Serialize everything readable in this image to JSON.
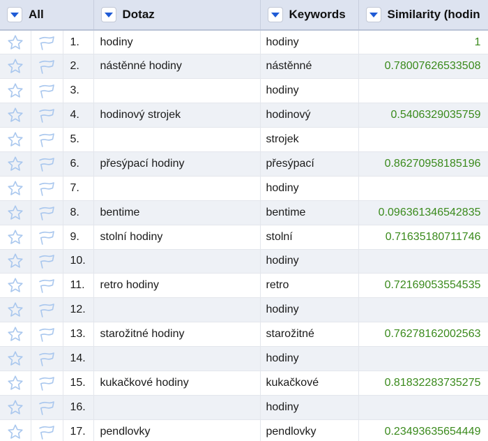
{
  "header": {
    "all_label": "All",
    "dotaz_label": "Dotaz",
    "keywords_label": "Keywords",
    "similarity_label": "Similarity (hodin"
  },
  "icons": {
    "dropdown": "triangle-down-icon",
    "star": "star-icon",
    "flag": "flag-icon"
  },
  "colors": {
    "header_bg": "#dde3f0",
    "dropdown_triangle": "#1f5bd6",
    "icon_outline": "#a9c7ee",
    "similarity_text": "#3a8a1c",
    "row_alt": "#eef1f6"
  },
  "rows": [
    {
      "num": "1.",
      "dotaz": "hodiny",
      "keyword": "hodiny",
      "similarity": "1"
    },
    {
      "num": "2.",
      "dotaz": "nástěnné hodiny",
      "keyword": "nástěnné",
      "similarity": "0.78007626533508"
    },
    {
      "num": "3.",
      "dotaz": "",
      "keyword": "hodiny",
      "similarity": ""
    },
    {
      "num": "4.",
      "dotaz": "hodinový strojek",
      "keyword": "hodinový",
      "similarity": "0.5406329035759"
    },
    {
      "num": "5.",
      "dotaz": "",
      "keyword": "strojek",
      "similarity": ""
    },
    {
      "num": "6.",
      "dotaz": "přesýpací hodiny",
      "keyword": "přesýpací",
      "similarity": "0.86270958185196"
    },
    {
      "num": "7.",
      "dotaz": "",
      "keyword": "hodiny",
      "similarity": ""
    },
    {
      "num": "8.",
      "dotaz": "bentime",
      "keyword": "bentime",
      "similarity": "0.096361346542835"
    },
    {
      "num": "9.",
      "dotaz": "stolní hodiny",
      "keyword": "stolní",
      "similarity": "0.71635180711746"
    },
    {
      "num": "10.",
      "dotaz": "",
      "keyword": "hodiny",
      "similarity": ""
    },
    {
      "num": "11.",
      "dotaz": "retro hodiny",
      "keyword": "retro",
      "similarity": "0.72169053554535"
    },
    {
      "num": "12.",
      "dotaz": "",
      "keyword": "hodiny",
      "similarity": ""
    },
    {
      "num": "13.",
      "dotaz": "starožitné hodiny",
      "keyword": "starožitné",
      "similarity": "0.76278162002563"
    },
    {
      "num": "14.",
      "dotaz": "",
      "keyword": "hodiny",
      "similarity": ""
    },
    {
      "num": "15.",
      "dotaz": "kukačkové hodiny",
      "keyword": "kukačkové",
      "similarity": "0.81832283735275"
    },
    {
      "num": "16.",
      "dotaz": "",
      "keyword": "hodiny",
      "similarity": ""
    },
    {
      "num": "17.",
      "dotaz": "pendlovky",
      "keyword": "pendlovky",
      "similarity": "0.23493635654449"
    }
  ]
}
